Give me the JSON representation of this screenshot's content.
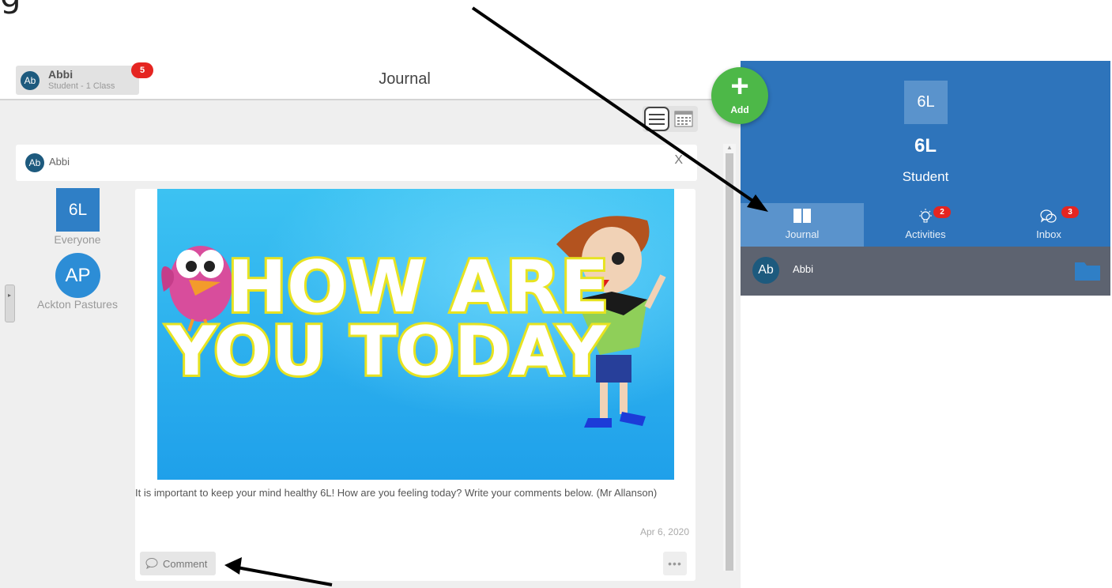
{
  "header": {
    "user_initials": "Ab",
    "user_name": "Abbi",
    "user_role": "Student - 1 Class",
    "notification_count": "5",
    "title": "Journal"
  },
  "crop_heading": "g",
  "add_button": {
    "plus": "+",
    "label": "Add"
  },
  "post": {
    "author_initials": "Ab",
    "author": "Abbi",
    "close": "X",
    "class_tile": "6L",
    "class_tile_label": "Everyone",
    "school_initials": "AP",
    "school_label": "Ackton Pastures",
    "image_text_line1": "HOW ARE",
    "image_text_line2": "YOU TODAY",
    "body": "It is important to keep your mind healthy 6L! How are you feeling today? Write your comments below. (Mr Allanson)",
    "date": "Apr 6, 2020",
    "comment_label": "Comment",
    "more": "•••"
  },
  "right_panel": {
    "tile": "6L",
    "class_name": "6L",
    "role": "Student",
    "tabs": [
      {
        "label": "Journal",
        "badge": ""
      },
      {
        "label": "Activities",
        "badge": "2"
      },
      {
        "label": "Inbox",
        "badge": "3"
      }
    ],
    "user_initials": "Ab",
    "user_name": "Abbi"
  },
  "colors": {
    "primary_blue": "#2e74bb",
    "active_tab": "#5a93cc",
    "add_green": "#4db848",
    "badge_red": "#e52521",
    "user_row": "#5d6370"
  }
}
